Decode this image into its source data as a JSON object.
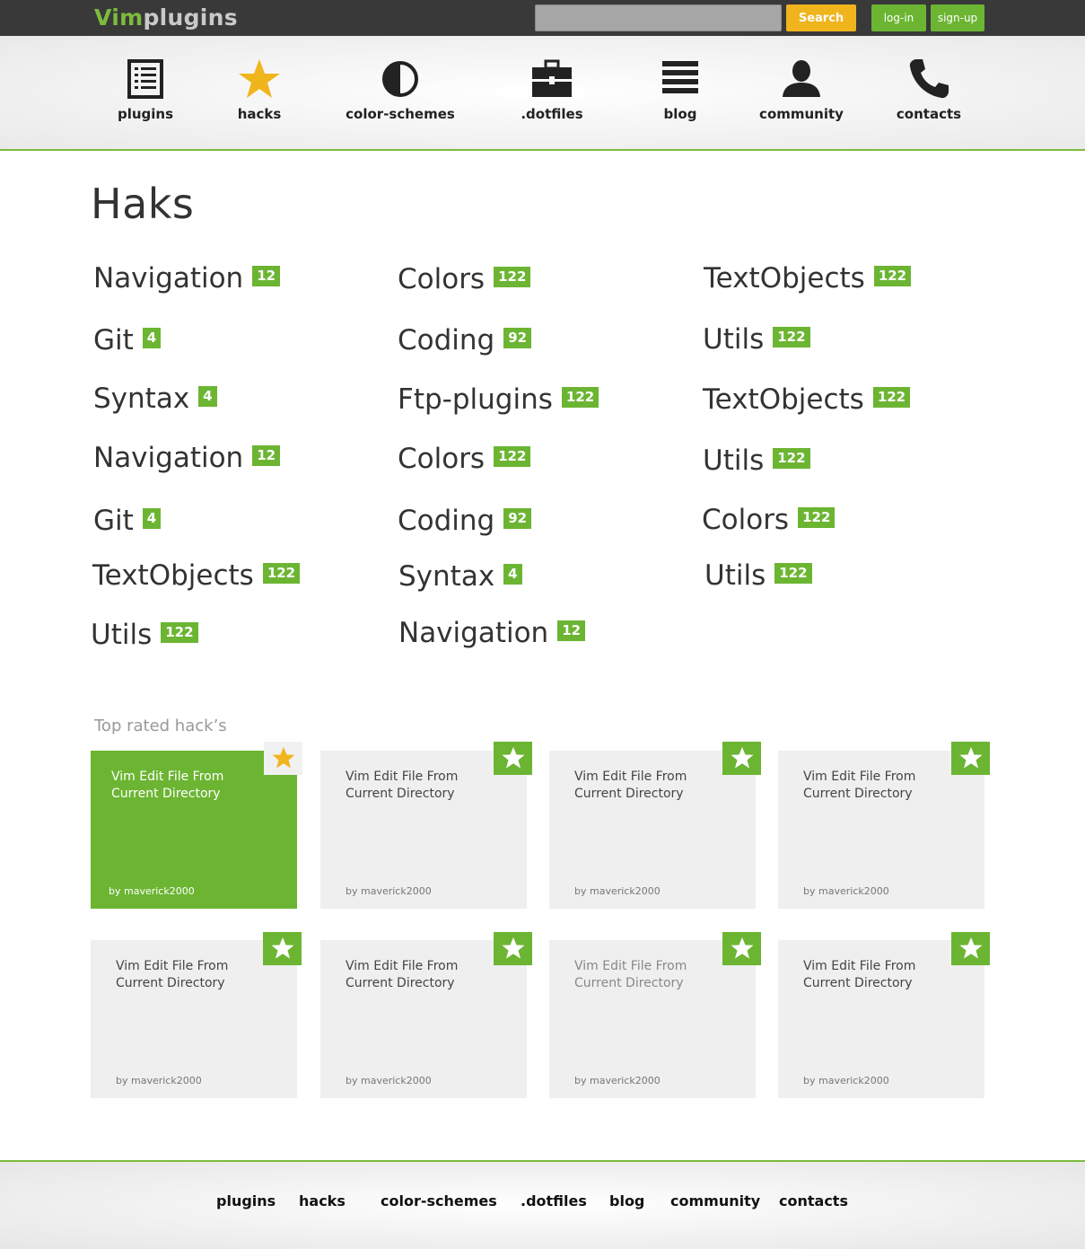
{
  "header": {
    "logo_vim": "Vim",
    "logo_plugins": "plugins",
    "search_value": "",
    "search_button": "Search",
    "login_button": "log-in",
    "signup_button": "sign-up"
  },
  "nav": [
    {
      "label": "plugins",
      "icon": "list-icon"
    },
    {
      "label": "hacks",
      "icon": "star-icon"
    },
    {
      "label": "color-schemes",
      "icon": "contrast-icon"
    },
    {
      "label": ".dotfiles",
      "icon": "briefcase-icon"
    },
    {
      "label": "blog",
      "icon": "menu-lines-icon"
    },
    {
      "label": "community",
      "icon": "user-icon"
    },
    {
      "label": "contacts",
      "icon": "phone-icon"
    }
  ],
  "page_title": "Haks",
  "categories": [
    {
      "name": "Navigation",
      "count": "12"
    },
    {
      "name": "Git",
      "count": "4"
    },
    {
      "name": "Syntax",
      "count": "4"
    },
    {
      "name": "Navigation",
      "count": "12"
    },
    {
      "name": "Git",
      "count": "4"
    },
    {
      "name": "TextObjects",
      "count": "122"
    },
    {
      "name": "Utils",
      "count": "122"
    },
    {
      "name": "Colors",
      "count": "122"
    },
    {
      "name": "Coding",
      "count": "92"
    },
    {
      "name": "Ftp-plugins",
      "count": "122"
    },
    {
      "name": "Colors",
      "count": "122"
    },
    {
      "name": "Coding",
      "count": "92"
    },
    {
      "name": "Syntax",
      "count": "4"
    },
    {
      "name": "Navigation",
      "count": "12"
    },
    {
      "name": "TextObjects",
      "count": "122"
    },
    {
      "name": "Utils",
      "count": "122"
    },
    {
      "name": "TextObjects",
      "count": "122"
    },
    {
      "name": "Utils",
      "count": "122"
    },
    {
      "name": "Colors",
      "count": "122"
    },
    {
      "name": "Utils",
      "count": "122"
    }
  ],
  "top_rated": {
    "title": "Top rated hack’s",
    "cards": [
      {
        "title": "Vim Edit File From Current Directory",
        "author": "by maverick2000",
        "state": "active"
      },
      {
        "title": "Vim Edit File From Current Directory",
        "author": "by maverick2000",
        "state": "normal"
      },
      {
        "title": "Vim Edit File From Current Directory",
        "author": "by maverick2000",
        "state": "normal"
      },
      {
        "title": "Vim Edit File From Current Directory",
        "author": "by maverick2000",
        "state": "normal"
      },
      {
        "title": "Vim Edit File From Current Directory",
        "author": "by maverick2000",
        "state": "normal"
      },
      {
        "title": "Vim Edit File From Current Directory",
        "author": "by maverick2000",
        "state": "normal"
      },
      {
        "title": "Vim Edit File From Current Directory",
        "author": "by maverick2000",
        "state": "faded"
      },
      {
        "title": "Vim Edit File From Current Directory",
        "author": "by maverick2000",
        "state": "normal"
      }
    ]
  },
  "footer": [
    "plugins",
    "hacks",
    "color-schemes",
    ".dotfiles",
    "blog",
    "community",
    "contacts"
  ],
  "colors": {
    "accent_green": "#6cb533",
    "accent_orange": "#f0b41c",
    "topbar": "#393939"
  }
}
